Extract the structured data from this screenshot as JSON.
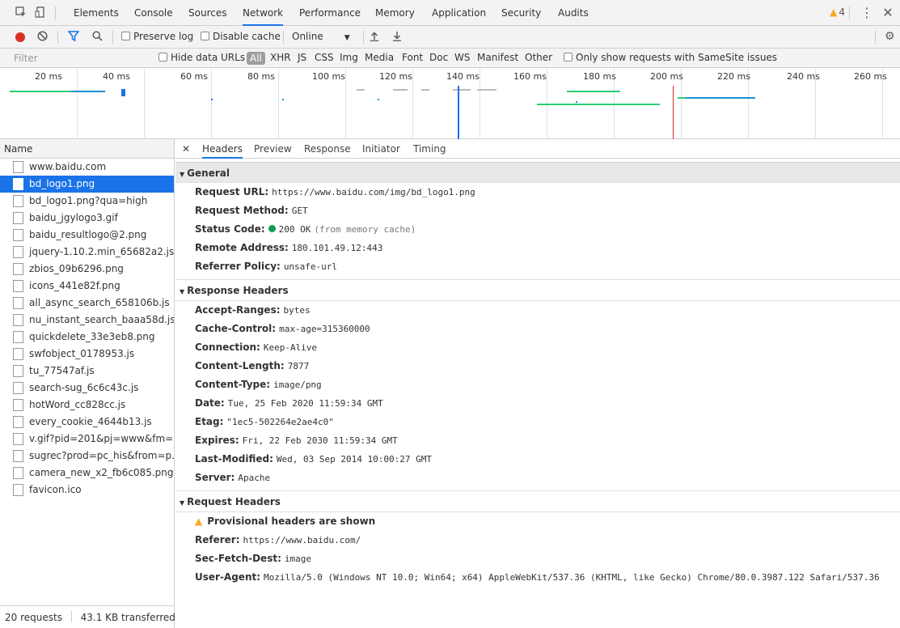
{
  "tabs": [
    "Elements",
    "Console",
    "Sources",
    "Network",
    "Performance",
    "Memory",
    "Application",
    "Security",
    "Audits"
  ],
  "active_tab": "Network",
  "warning_count": "4",
  "toolbar": {
    "preserve_log": "Preserve log",
    "disable_cache": "Disable cache",
    "throttle": "Online"
  },
  "filter": {
    "placeholder": "Filter",
    "hide_data_urls": "Hide data URLs",
    "types": [
      "All",
      "XHR",
      "JS",
      "CSS",
      "Img",
      "Media",
      "Font",
      "Doc",
      "WS",
      "Manifest",
      "Other"
    ],
    "samesite": "Only show requests with SameSite issues"
  },
  "timeline": {
    "ticks": [
      "20 ms",
      "40 ms",
      "60 ms",
      "80 ms",
      "100 ms",
      "120 ms",
      "140 ms",
      "160 ms",
      "180 ms",
      "200 ms",
      "220 ms",
      "240 ms",
      "260 ms"
    ]
  },
  "list": {
    "header": "Name",
    "items": [
      "www.baidu.com",
      "bd_logo1.png",
      "bd_logo1.png?qua=high",
      "baidu_jgylogo3.gif",
      "baidu_resultlogo@2.png",
      "jquery-1.10.2.min_65682a2.js",
      "zbios_09b6296.png",
      "icons_441e82f.png",
      "all_async_search_658106b.js",
      "nu_instant_search_baaa58d.js",
      "quickdelete_33e3eb8.png",
      "swfobject_0178953.js",
      "tu_77547af.js",
      "search-sug_6c6c43c.js",
      "hotWord_cc828cc.js",
      "every_cookie_4644b13.js",
      "v.gif?pid=201&pj=www&fm=...",
      "sugrec?prod=pc_his&from=p...",
      "camera_new_x2_fb6c085.png",
      "favicon.ico"
    ],
    "selected_index": 1,
    "footer_requests": "20 requests",
    "footer_transferred": "43.1 KB transferred"
  },
  "detail_tabs": [
    "Headers",
    "Preview",
    "Response",
    "Initiator",
    "Timing"
  ],
  "general": {
    "title": "General",
    "rows": [
      {
        "k": "Request URL:",
        "v": "https://www.baidu.com/img/bd_logo1.png"
      },
      {
        "k": "Request Method:",
        "v": "GET"
      },
      {
        "k": "Status Code:",
        "v": "200 OK",
        "extra": "(from memory cache)"
      },
      {
        "k": "Remote Address:",
        "v": "180.101.49.12:443"
      },
      {
        "k": "Referrer Policy:",
        "v": "unsafe-url"
      }
    ]
  },
  "response_headers": {
    "title": "Response Headers",
    "rows": [
      {
        "k": "Accept-Ranges:",
        "v": "bytes"
      },
      {
        "k": "Cache-Control:",
        "v": "max-age=315360000"
      },
      {
        "k": "Connection:",
        "v": "Keep-Alive"
      },
      {
        "k": "Content-Length:",
        "v": "7877"
      },
      {
        "k": "Content-Type:",
        "v": "image/png"
      },
      {
        "k": "Date:",
        "v": "Tue, 25 Feb 2020 11:59:34 GMT"
      },
      {
        "k": "Etag:",
        "v": "\"1ec5-502264e2ae4c0\""
      },
      {
        "k": "Expires:",
        "v": "Fri, 22 Feb 2030 11:59:34 GMT"
      },
      {
        "k": "Last-Modified:",
        "v": "Wed, 03 Sep 2014 10:00:27 GMT"
      },
      {
        "k": "Server:",
        "v": "Apache"
      }
    ]
  },
  "request_headers": {
    "title": "Request Headers",
    "provisional": "Provisional headers are shown",
    "rows": [
      {
        "k": "Referer:",
        "v": "https://www.baidu.com/"
      },
      {
        "k": "Sec-Fetch-Dest:",
        "v": "image"
      },
      {
        "k": "User-Agent:",
        "v": "Mozilla/5.0 (Windows NT 10.0; Win64; x64) AppleWebKit/537.36 (KHTML, like Gecko) Chrome/80.0.3987.122 Safari/537.36"
      }
    ]
  },
  "colors": {
    "accent": "#1a73e8",
    "record": "#d93025",
    "status_ok": "#0f9d58",
    "warning": "#f9a825"
  }
}
